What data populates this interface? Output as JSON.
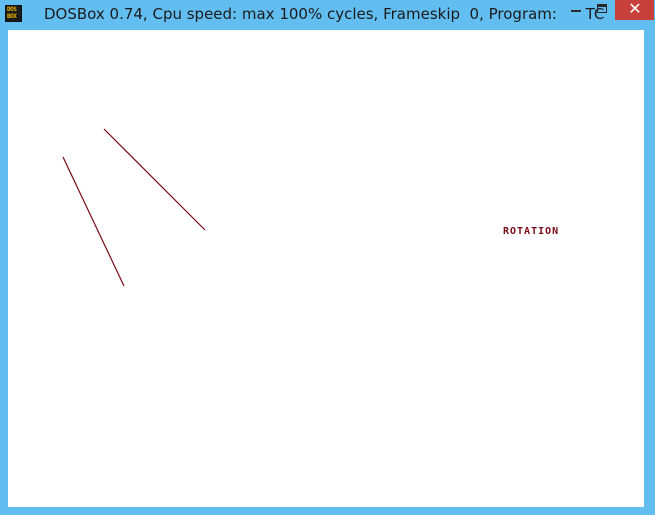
{
  "window": {
    "title": "DOSBox 0.74, Cpu speed: max 100% cycles, Frameskip  0, Program:      TC",
    "icon": "dosbox-icon",
    "icon_text_line1": "DOS",
    "icon_text_line2": "BOX",
    "controls": {
      "minimize": "minimize-icon",
      "maximize": "maximize-icon",
      "close": "close-icon",
      "close_glyph": "✕"
    },
    "accent_color": "#62bdf1",
    "close_color": "#c7413a"
  },
  "canvas": {
    "background": "#ffffff",
    "line_color": "#7a0a14",
    "label": "ROTATION"
  }
}
